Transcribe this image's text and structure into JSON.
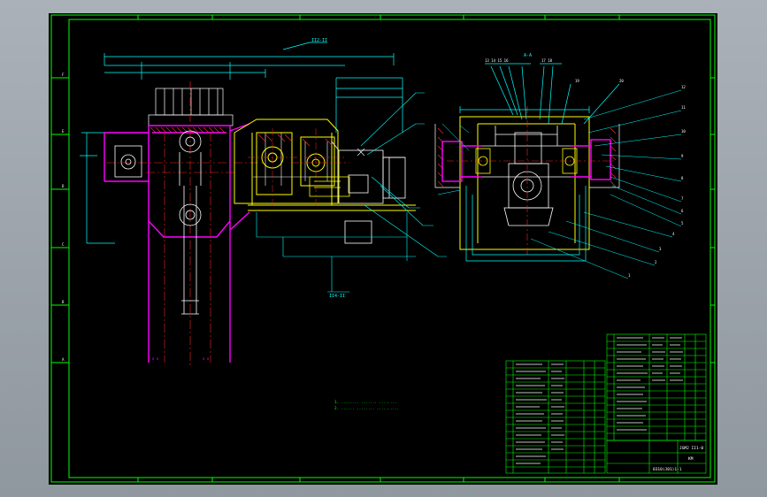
{
  "drawing": {
    "view_label_left": "II2-II",
    "view_label_section": "A-A",
    "view_label_bottom": "II4-II",
    "drawing_number": "JGM2 II1-0",
    "sheet_code": "KM",
    "project_code": "0310(J01)1-1",
    "technical_notes": [
      "1.  ........  .......  ........",
      "2.  ......  ........  .........."
    ]
  },
  "colors": {
    "canvas_bg": "#000000",
    "frame": "#00ff00",
    "gearbox_outline": "#ffff00",
    "housing": "#ff00ff",
    "dimension": "#00ffff",
    "centerline": "#ff2020",
    "detail": "#ffffff",
    "hatch": "#ff3030"
  },
  "icons": {
    "crosshair": "zoom-target-icon"
  }
}
